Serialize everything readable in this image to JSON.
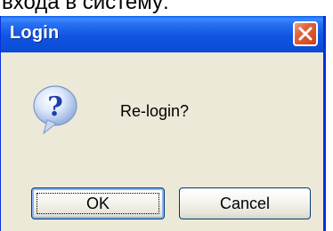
{
  "background": {
    "caption": "входа в систему:"
  },
  "dialog": {
    "title": "Login",
    "message": "Re-login?",
    "buttons": {
      "ok": "OK",
      "cancel": "Cancel"
    },
    "icons": {
      "close": "close-icon",
      "message": "question-icon"
    }
  },
  "colors": {
    "titlebar": "#0c4fd8",
    "close_button": "#d8491f",
    "client_bg": "#ece9d8",
    "button_border": "#003c74"
  }
}
